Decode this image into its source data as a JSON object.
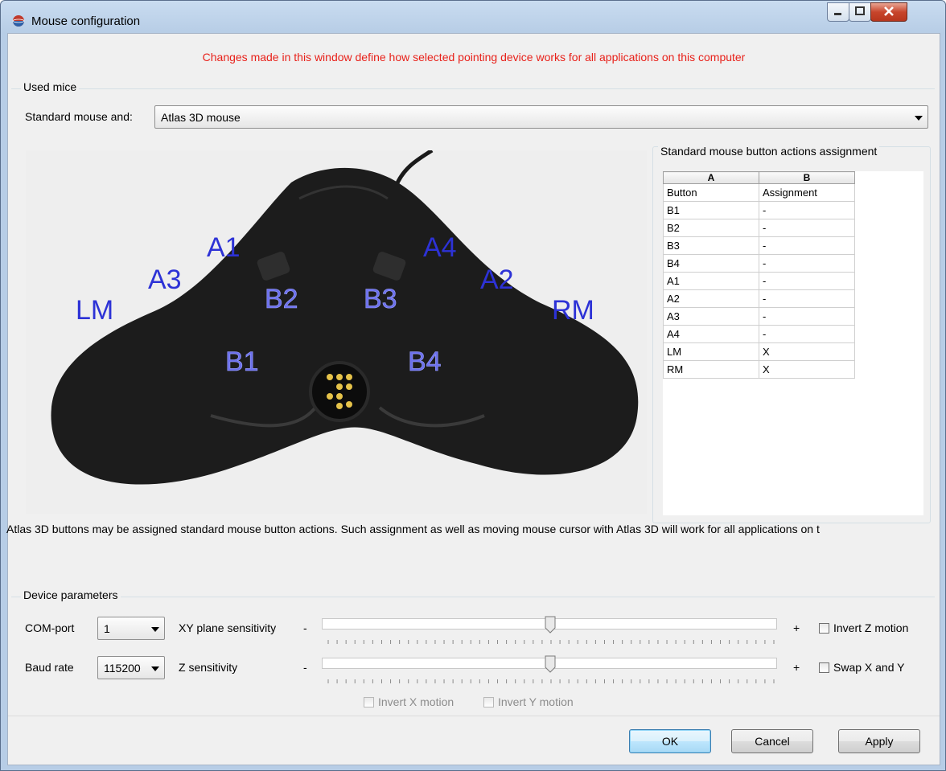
{
  "window": {
    "title": "Mouse configuration"
  },
  "warning": "Changes made in this window define how selected pointing device works for all applications on this computer",
  "used_mice": {
    "group_label": "Used mice",
    "label": "Standard mouse and:",
    "selected": "Atlas 3D mouse"
  },
  "photo_labels": {
    "lm": "LM",
    "a3": "A3",
    "a1": "A1",
    "b2": "B2",
    "b3": "B3",
    "a4": "A4",
    "a2": "A2",
    "rm": "RM",
    "b1": "B1",
    "b4": "B4"
  },
  "assignment": {
    "group_label": "Standard mouse button actions assignment",
    "col_letters": [
      "A",
      "B"
    ],
    "header": [
      "Button",
      "Assignment"
    ],
    "rows": [
      [
        "B1",
        "-"
      ],
      [
        "B2",
        "-"
      ],
      [
        "B3",
        "-"
      ],
      [
        "B4",
        "-"
      ],
      [
        "A1",
        "-"
      ],
      [
        "A2",
        "-"
      ],
      [
        "A3",
        "-"
      ],
      [
        "A4",
        "-"
      ],
      [
        "LM",
        "X"
      ],
      [
        "RM",
        "X"
      ]
    ]
  },
  "info_text": "Atlas 3D buttons may be assigned standard mouse button actions. Such assignment as well as moving mouse cursor with Atlas 3D will work for all applications on t",
  "device": {
    "group_label": "Device parameters",
    "com_label": "COM-port",
    "com_value": "1",
    "baud_label": "Baud rate",
    "baud_value": "115200",
    "xy_label": "XY plane sensitivity",
    "z_label": "Z sensitivity",
    "minus": "-",
    "plus": "+",
    "xy_level": 0.5,
    "z_level": 0.5,
    "invert_z": "Invert Z motion",
    "swap_xy": "Swap X and Y",
    "invert_x": "Invert X motion",
    "invert_y": "Invert Y motion"
  },
  "buttons": {
    "ok": "OK",
    "cancel": "Cancel",
    "apply": "Apply"
  }
}
